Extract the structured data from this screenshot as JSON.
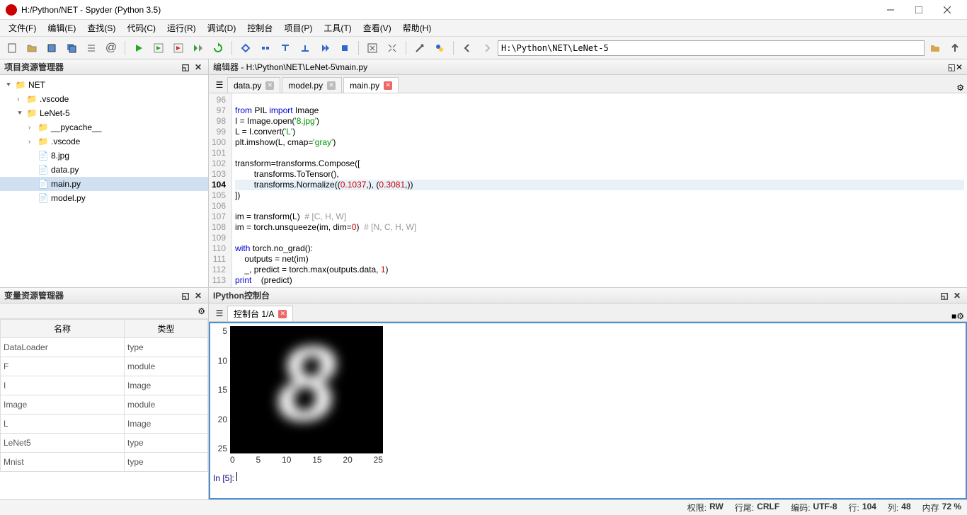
{
  "window": {
    "title": "H:/Python/NET - Spyder (Python 3.5)"
  },
  "menu": {
    "items": [
      "文件(F)",
      "编辑(E)",
      "查找(S)",
      "代码(C)",
      "运行(R)",
      "调试(D)",
      "控制台",
      "项目(P)",
      "工具(T)",
      "查看(V)",
      "帮助(H)"
    ]
  },
  "toolbar": {
    "path": "H:\\Python\\NET\\LeNet-5"
  },
  "project_explorer": {
    "title": "项目资源管理器",
    "root": "NET",
    "folders": {
      "vscode_root": ".vscode",
      "lenet5": "LeNet-5",
      "pycache": "__pycache__",
      "vscode": ".vscode"
    },
    "files": {
      "jpg": "8.jpg",
      "data": "data.py",
      "main": "main.py",
      "model": "model.py"
    }
  },
  "var_explorer": {
    "title": "变量资源管理器",
    "columns": {
      "name": "名称",
      "type": "类型"
    },
    "rows": [
      {
        "name": "DataLoader",
        "type": "type"
      },
      {
        "name": "F",
        "type": "module"
      },
      {
        "name": "I",
        "type": "Image"
      },
      {
        "name": "Image",
        "type": "module"
      },
      {
        "name": "L",
        "type": "Image"
      },
      {
        "name": "LeNet5",
        "type": "type"
      },
      {
        "name": "Mnist",
        "type": "type"
      }
    ]
  },
  "editor": {
    "title": "编辑器 - H:\\Python\\NET\\LeNet-5\\main.py",
    "tabs": [
      {
        "label": "data.py",
        "active": false
      },
      {
        "label": "model.py",
        "active": false
      },
      {
        "label": "main.py",
        "active": true
      }
    ],
    "lines": {
      "96": "",
      "97": {
        "pre": "",
        "kw": "from",
        "mid": " PIL ",
        "kw2": "import",
        "post": " Image"
      },
      "98": {
        "text": "I = Image.open(",
        "str": "'8.jpg'",
        "post": ")"
      },
      "99": {
        "text": "L = I.convert(",
        "str": "'L'",
        "post": ")"
      },
      "100": {
        "text": "plt.imshow(L, cmap=",
        "str": "'gray'",
        "post": ")"
      },
      "101": "",
      "102": "transform=transforms.Compose([",
      "103": "        transforms.ToTensor(),",
      "104": {
        "text": "        transforms.Normalize((",
        "n1": "0.1037",
        "mid": ",), (",
        "n2": "0.3081",
        "post": ",))"
      },
      "105": "])",
      "106": "",
      "107": {
        "text": "im = transform(L)  ",
        "cm": "# [C, H, W]"
      },
      "108": {
        "text": "im = torch.unsqueeze(im, dim=",
        "n": "0",
        "mid": ")  ",
        "cm": "# [N, C, H, W]"
      },
      "109": "",
      "110": {
        "kw": "with",
        "text": " torch.no_grad():"
      },
      "111": "    outputs = net(im)",
      "112": {
        "text": "    _, predict = torch.max(outputs.data, ",
        "n": "1",
        "post": ")"
      },
      "113": {
        "text": "    ",
        "kw": "print",
        "post": "(predict)"
      }
    }
  },
  "console": {
    "title": "IPython控制台",
    "tab": "控制台 1/A",
    "prompt": "In [5]: "
  },
  "chart_data": {
    "type": "heatmap",
    "title": "",
    "xlabel": "",
    "ylabel": "",
    "x_ticks": [
      "0",
      "5",
      "10",
      "15",
      "20",
      "25"
    ],
    "y_ticks": [
      "5",
      "10",
      "15",
      "20",
      "25"
    ],
    "xlim": [
      0,
      27
    ],
    "ylim": [
      0,
      27
    ],
    "description": "28x28 grayscale MNIST-style image showing handwritten digit 8, white strokes on black background"
  },
  "status": {
    "perm_label": "权限:",
    "perm": "RW",
    "eol_label": "行尾:",
    "eol": "CRLF",
    "enc_label": "编码:",
    "enc": "UTF-8",
    "line_label": "行:",
    "line": "104",
    "col_label": "列:",
    "col": "48",
    "mem_label": "内存",
    "mem": "72 %"
  }
}
